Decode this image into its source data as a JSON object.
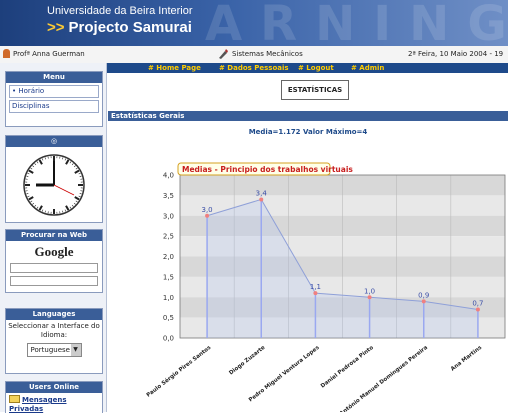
{
  "header": {
    "university": "Universidade da Beira Interior",
    "arrows": ">>",
    "project": "Projecto Samurai",
    "watermark": "ARNING"
  },
  "info_bar": {
    "user": "Profª Anna Guerman",
    "subject": "Sistemas Mecânicos",
    "date": "2ª Feira, 10 Maio 2004 - 19"
  },
  "nav": [
    "# Home Page",
    "# Dados Pessoais",
    "# Logout",
    "# Admin"
  ],
  "sidebar": {
    "menu_title": "Menu",
    "menu_items": [
      "• Horário",
      "Disciplinas"
    ],
    "clock_title": "◎",
    "search_title": "Procurar na Web",
    "google": "Google",
    "languages_title": "Languages",
    "languages_text": "Seleccionar a Interface do Idioma:",
    "language_selected": "Portuguese",
    "users_title": "Users Online",
    "messages_label": "Mensagens Privadas"
  },
  "page": {
    "title": "ESTATÍSTICAS",
    "section": "Estatísticas Gerais",
    "summary": "Media=1.172  Valor Máximo=4"
  },
  "chart_data": {
    "type": "line",
    "title": "Medias - Principio dos trabalhos virtuais",
    "categories": [
      "Paulo Sérgio Pires Santos",
      "Diogo Zuzarte",
      "Pedro Miguel Ventura Lopes",
      "Daniel Pedrosa Pinto",
      "António Manuel Domingues Pereira",
      "Ana Martins"
    ],
    "values": [
      3.0,
      3.4,
      1.1,
      1.0,
      0.9,
      0.7
    ],
    "value_labels": [
      "3,0",
      "3,4",
      "1,1",
      "1,0",
      "0,9",
      "0,7"
    ],
    "yticks": [
      "0,0",
      "0,5",
      "1,0",
      "1,5",
      "2,0",
      "2,5",
      "3,0",
      "3,5",
      "4,0"
    ],
    "ylim": [
      0,
      4
    ],
    "grid": true,
    "colors": {
      "line": "#8fa0d8",
      "stem": "#9aa8f0",
      "marker": "#f08080",
      "label": "#3b4fa8"
    }
  }
}
